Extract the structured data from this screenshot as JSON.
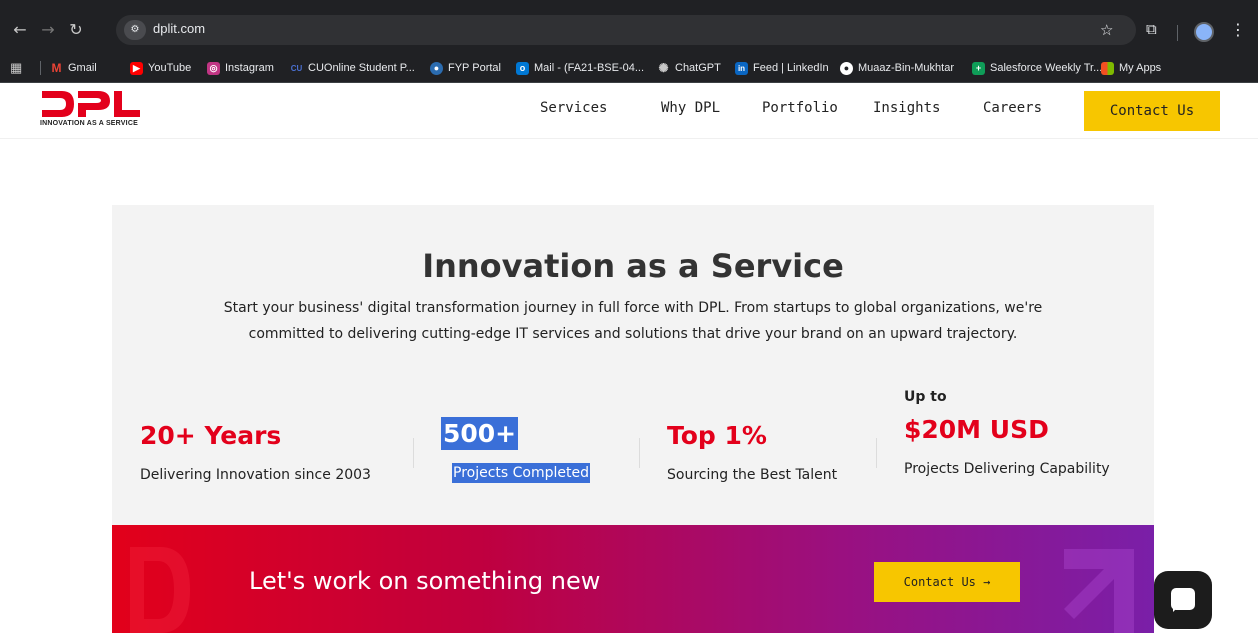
{
  "browser": {
    "url": "dplit.com",
    "bookmarks": [
      {
        "label": "Gmail",
        "icon": "gmail-icon",
        "color": "#ea4335"
      },
      {
        "label": "YouTube",
        "icon": "youtube-icon",
        "color": "#ff0000"
      },
      {
        "label": "Instagram",
        "icon": "instagram-icon",
        "color": "#c13584"
      },
      {
        "label": "CUOnline Student P...",
        "icon": "cuonline-icon",
        "color": "#1a3a8a"
      },
      {
        "label": "FYP Portal",
        "icon": "fyp-portal-icon",
        "color": "#2b6cb0"
      },
      {
        "label": "Mail - (FA21-BSE-04...",
        "icon": "outlook-icon",
        "color": "#0078d4"
      },
      {
        "label": "ChatGPT",
        "icon": "chatgpt-icon",
        "color": "#5f6368"
      },
      {
        "label": "Feed | LinkedIn",
        "icon": "linkedin-icon",
        "color": "#0a66c2"
      },
      {
        "label": "Muaaz-Bin-Mukhtar",
        "icon": "github-icon",
        "color": "#ffffff"
      },
      {
        "label": "Salesforce Weekly Tr...",
        "icon": "sheets-icon",
        "color": "#0f9d58"
      },
      {
        "label": "My Apps",
        "icon": "microsoft-apps-icon",
        "color": "#f25022"
      }
    ]
  },
  "header": {
    "logo_tagline": "INNOVATION AS A SERVICE",
    "nav": [
      "Services",
      "Why DPL",
      "Portfolio",
      "Insights",
      "Careers"
    ],
    "contact_label": "Contact Us",
    "brand_color": "#e3001b",
    "accent_color": "#f7c600"
  },
  "hero": {
    "title": "Innovation as a Service",
    "description": "Start your business' digital transformation journey in full force with DPL. From startups to global organizations, we're committed to delivering cutting-edge IT services and solutions that drive your brand on an upward trajectory.",
    "stats": [
      {
        "value": "20+ Years",
        "label": "Delivering Innovation since 2003"
      },
      {
        "value": "500+",
        "label": "Projects Completed"
      },
      {
        "value": "Top 1%",
        "label": "Sourcing the Best Talent"
      },
      {
        "prefix": "Up to",
        "value": "$20M USD",
        "label": "Projects Delivering Capability"
      }
    ]
  },
  "cta": {
    "text": "Let's work on something new",
    "button_label": "Contact Us"
  }
}
